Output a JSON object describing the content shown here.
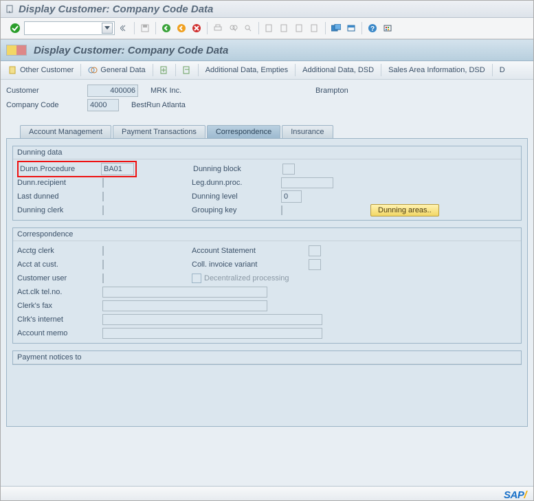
{
  "window": {
    "title": "Display Customer: Company Code Data"
  },
  "header": {
    "title": "Display Customer: Company Code Data"
  },
  "apptoolbar": {
    "other_customer": "Other Customer",
    "general_data": "General Data",
    "add_empties": "Additional Data, Empties",
    "add_dsd": "Additional Data, DSD",
    "sales_area_dsd": "Sales Area Information, DSD",
    "more": "D"
  },
  "info": {
    "customer_lbl": "Customer",
    "customer_no": "400006",
    "customer_name": "MRK Inc.",
    "customer_city": "Brampton",
    "cc_lbl": "Company Code",
    "cc_no": "4000",
    "cc_name": "BestRun Atlanta"
  },
  "tabs": {
    "t1": "Account Management",
    "t2": "Payment Transactions",
    "t3": "Correspondence",
    "t4": "Insurance"
  },
  "dunning": {
    "group": "Dunning data",
    "procedure_lbl": "Dunn.Procedure",
    "procedure_val": "BA01",
    "recipient_lbl": "Dunn.recipient",
    "last_dunned_lbl": "Last dunned",
    "clerk_lbl": "Dunning clerk",
    "block_lbl": "Dunning block",
    "leg_lbl": "Leg.dunn.proc.",
    "level_lbl": "Dunning level",
    "level_val": "0",
    "grouping_lbl": "Grouping key",
    "areas_btn": "Dunning areas.."
  },
  "corr": {
    "group": "Correspondence",
    "acctg_clerk": "Acctg clerk",
    "acct_cust": "Acct at cust.",
    "customer_user": "Customer user",
    "actclk_tel": "Act.clk tel.no.",
    "clerk_fax": "Clerk's fax",
    "clrk_internet": "Clrk's internet",
    "account_memo": "Account memo",
    "acct_stmt": "Account Statement",
    "coll_inv": "Coll. invoice variant",
    "decentralized": "Decentralized processing"
  },
  "payment_notices": {
    "group": "Payment notices to"
  }
}
